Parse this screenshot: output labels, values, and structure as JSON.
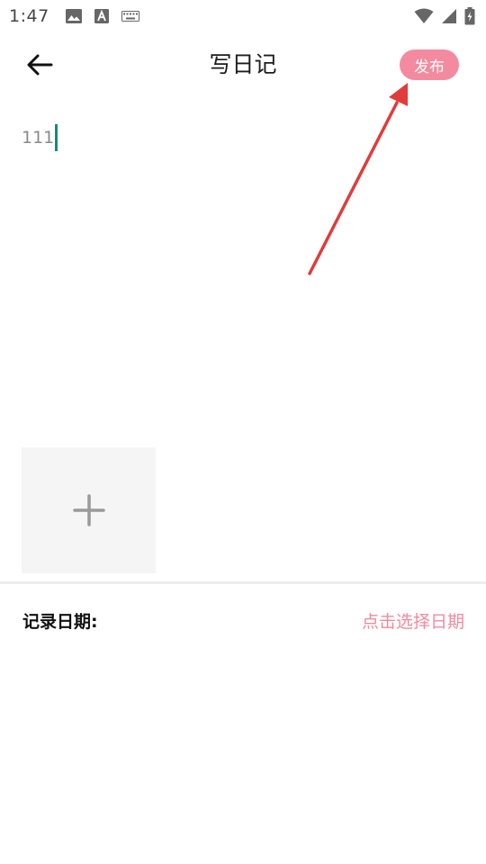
{
  "status_bar": {
    "time": "1:47"
  },
  "header": {
    "title": "写日记",
    "publish_label": "发布"
  },
  "editor": {
    "text": "111"
  },
  "date_row": {
    "label": "记录日期:",
    "picker_text": "点击选择日期"
  },
  "colors": {
    "accent": "#f48aa0",
    "cursor": "#0a8f7c",
    "annotation": "#e03c3c"
  },
  "icons": {
    "back": "arrow-left-icon",
    "add": "plus-icon"
  }
}
